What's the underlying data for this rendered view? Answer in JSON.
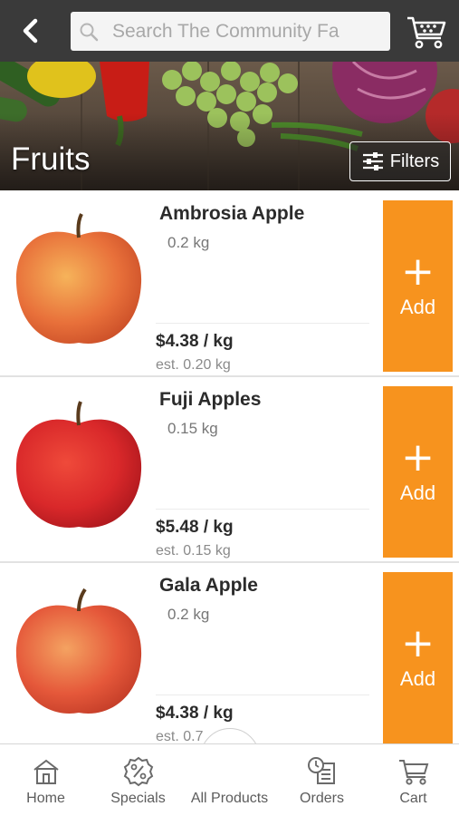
{
  "header": {
    "back_icon": "chevron-left-icon",
    "search": {
      "placeholder": "Search The Community Fa",
      "value": ""
    },
    "cart_icon": "shopping-cart-icon"
  },
  "banner": {
    "title": "Fruits",
    "filters_label": "Filters",
    "filters_icon": "sliders-icon"
  },
  "products": [
    {
      "name": "Ambrosia Apple",
      "weight": "0.2 kg",
      "price": "$4.38 / kg",
      "est": "est. 0.20 kg",
      "add_label": "Add",
      "apple_color": "#e8703a"
    },
    {
      "name": "Fuji Apples",
      "weight": "0.15 kg",
      "price": "$5.48 / kg",
      "est": "est. 0.15 kg",
      "add_label": "Add",
      "apple_color": "#d9282a"
    },
    {
      "name": "Gala Apple",
      "weight": "0.2 kg",
      "price": "$4.38 / kg",
      "est": "est. 0.7",
      "add_label": "Add",
      "apple_color": "#e5583a"
    }
  ],
  "bottom_nav": [
    {
      "label": "Home",
      "icon": "home-icon"
    },
    {
      "label": "Specials",
      "icon": "percent-badge-icon"
    },
    {
      "label": "All Products",
      "icon": "list-icon"
    },
    {
      "label": "Orders",
      "icon": "orders-clock-icon"
    },
    {
      "label": "Cart",
      "icon": "cart-icon"
    }
  ],
  "colors": {
    "topbar": "#3a3a3a",
    "accent": "#f7931e",
    "text_dark": "#2b2b2b"
  }
}
